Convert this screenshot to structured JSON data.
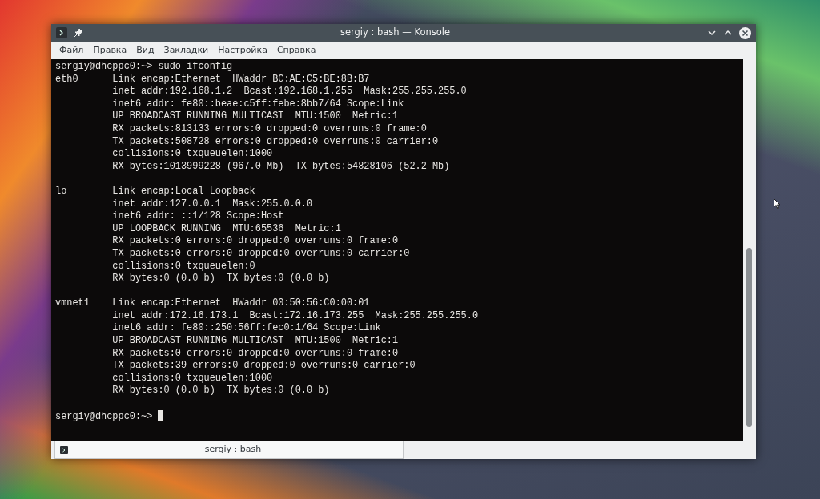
{
  "window": {
    "title": "sergiy : bash — Konsole"
  },
  "menu": [
    "Файл",
    "Правка",
    "Вид",
    "Закладки",
    "Настройка",
    "Справка"
  ],
  "terminal": {
    "command_prompt": "sergiy@dhcppc0:~> sudo ifconfig",
    "blocks": [
      [
        "eth0      Link encap:Ethernet  HWaddr BC:AE:C5:BE:8B:B7",
        "          inet addr:192.168.1.2  Bcast:192.168.1.255  Mask:255.255.255.0",
        "          inet6 addr: fe80::beae:c5ff:febe:8bb7/64 Scope:Link",
        "          UP BROADCAST RUNNING MULTICAST  MTU:1500  Metric:1",
        "          RX packets:813133 errors:0 dropped:0 overruns:0 frame:0",
        "          TX packets:508728 errors:0 dropped:0 overruns:0 carrier:0",
        "          collisions:0 txqueuelen:1000",
        "          RX bytes:1013999228 (967.0 Mb)  TX bytes:54828106 (52.2 Mb)"
      ],
      [
        "lo        Link encap:Local Loopback",
        "          inet addr:127.0.0.1  Mask:255.0.0.0",
        "          inet6 addr: ::1/128 Scope:Host",
        "          UP LOOPBACK RUNNING  MTU:65536  Metric:1",
        "          RX packets:0 errors:0 dropped:0 overruns:0 frame:0",
        "          TX packets:0 errors:0 dropped:0 overruns:0 carrier:0",
        "          collisions:0 txqueuelen:0",
        "          RX bytes:0 (0.0 b)  TX bytes:0 (0.0 b)"
      ],
      [
        "vmnet1    Link encap:Ethernet  HWaddr 00:50:56:C0:00:01",
        "          inet addr:172.16.173.1  Bcast:172.16.173.255  Mask:255.255.255.0",
        "          inet6 addr: fe80::250:56ff:fec0:1/64 Scope:Link",
        "          UP BROADCAST RUNNING MULTICAST  MTU:1500  Metric:1",
        "          RX packets:0 errors:0 dropped:0 overruns:0 frame:0",
        "          TX packets:39 errors:0 dropped:0 overruns:0 carrier:0",
        "          collisions:0 txqueuelen:1000",
        "          RX bytes:0 (0.0 b)  TX bytes:0 (0.0 b)"
      ]
    ],
    "prompt": "sergiy@dhcppc0:~>"
  },
  "tabs": [
    {
      "label": "sergiy : bash",
      "selected": true
    }
  ]
}
